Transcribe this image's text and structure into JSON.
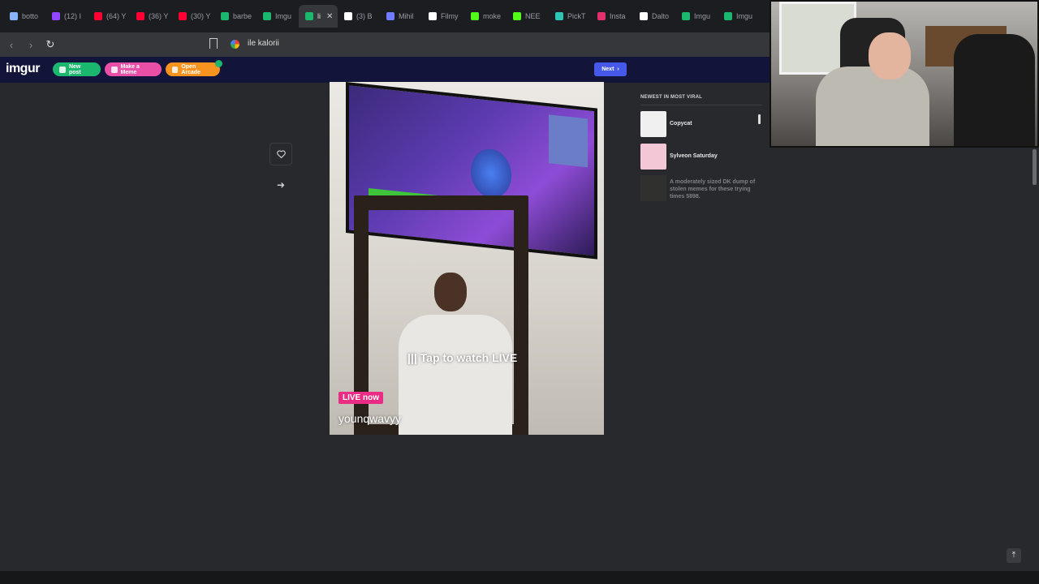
{
  "browser": {
    "tabs": [
      {
        "label": "botto",
        "icon": "robot-icon",
        "color": "#8ab4f8"
      },
      {
        "label": "(12) I",
        "icon": "twitch-icon",
        "color": "#9146ff"
      },
      {
        "label": "(64) Y",
        "icon": "youtube-icon",
        "color": "#ff0033"
      },
      {
        "label": "(36) Y",
        "icon": "youtube-icon",
        "color": "#ff0033"
      },
      {
        "label": "(30) Y",
        "icon": "youtube-icon",
        "color": "#ff0033"
      },
      {
        "label": "barbe",
        "icon": "imgur-icon",
        "color": "#1bb76e"
      },
      {
        "label": "Imgu",
        "icon": "imgur-icon",
        "color": "#1bb76e"
      },
      {
        "label": "li",
        "icon": "imgur-icon",
        "color": "#1bb76e",
        "active": true
      },
      {
        "label": "(3) B",
        "icon": "x-icon",
        "color": "#ffffff"
      },
      {
        "label": "Mihil",
        "icon": "info-icon",
        "color": "#6f7cff"
      },
      {
        "label": "Filmy",
        "icon": "tiktok-icon",
        "color": "#ffffff"
      },
      {
        "label": "moke",
        "icon": "kick-icon",
        "color": "#53fc18"
      },
      {
        "label": "NEE",
        "icon": "kick-icon",
        "color": "#53fc18"
      },
      {
        "label": "PickT",
        "icon": "pick-icon",
        "color": "#2ec4b6"
      },
      {
        "label": "Insta",
        "icon": "instagram-icon",
        "color": "#e1306c"
      },
      {
        "label": "Dalto",
        "icon": "x-icon",
        "color": "#ffffff"
      },
      {
        "label": "Imgu",
        "icon": "imgur-icon",
        "color": "#1bb76e"
      },
      {
        "label": "Imgu",
        "icon": "imgur-icon",
        "color": "#1bb76e"
      }
    ],
    "address": "ile kalorii"
  },
  "header": {
    "logo": "imgur",
    "new_post": "New post",
    "make_meme": "Make a Meme",
    "open_arcade": "Open Arcade",
    "next": "Next"
  },
  "post": {
    "live_overlay": "Tap to watch LIVE",
    "live_badge": "LIVE now",
    "username": "younqwavyy"
  },
  "sidebar": {
    "title": "NEWEST IN MOST VIRAL",
    "items": [
      {
        "label": "Copycat",
        "thumb_color": "#f0f0f0"
      },
      {
        "label": "Sylveon Saturday",
        "thumb_color": "#f3c7d6"
      },
      {
        "label": "A moderately sized DK dump of stolen memes for these trying times 5898.",
        "thumb_color": "#3b3a30"
      }
    ]
  }
}
